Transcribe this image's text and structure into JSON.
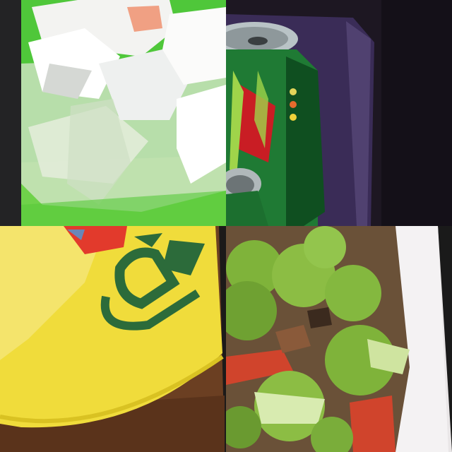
{
  "collage": {
    "tiles": [
      {
        "id": "paper-waste-in-clear-bag",
        "palette": {
          "background": "#3dba2a",
          "bag": "#d9e6d0",
          "paper": "#f3f3f1"
        }
      },
      {
        "id": "green-soda-cans-in-bin",
        "palette": {
          "bin": "#3a2c57",
          "can": "#1f7a34",
          "rim": "#b9c3c6",
          "logo_red": "#c91d24"
        }
      },
      {
        "id": "yellow-plastic-bag",
        "palette": {
          "bag": "#f0dc3b",
          "print": "#2c6b3a",
          "wood": "#6b3f22"
        }
      },
      {
        "id": "broccoli-stir-fry-plate",
        "palette": {
          "broccoli": "#7fb33a",
          "pepper": "#d0442c",
          "plate": "#f1eff0"
        }
      }
    ]
  }
}
